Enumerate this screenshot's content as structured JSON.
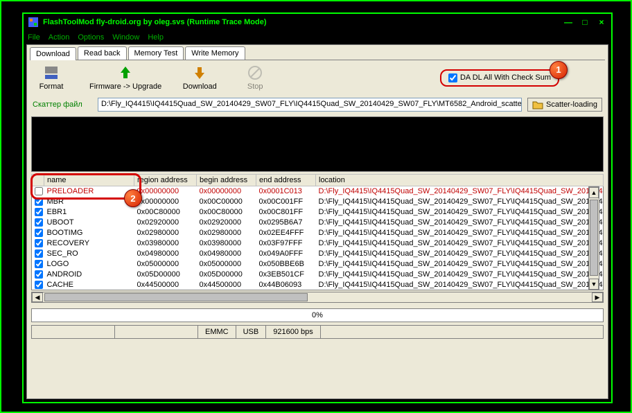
{
  "window": {
    "title": "FlashToolMod fly-droid.org by oleg.svs (Runtime Trace Mode)"
  },
  "menu": {
    "file": "File",
    "action": "Action",
    "options": "Options",
    "window": "Window",
    "help": "Help"
  },
  "tabs": {
    "download": "Download",
    "readback": "Read back",
    "memtest": "Memory Test",
    "writemem": "Write Memory"
  },
  "toolbar": {
    "format": "Format",
    "firmware_upgrade": "Firmware -> Upgrade",
    "download": "Download",
    "stop": "Stop",
    "checksum_label": "DA DL All With Check Sum"
  },
  "scatter": {
    "label": "Скаттер файл",
    "path": "D:\\Fly_IQ4415\\IQ4415Quad_SW_20140429_SW07_FLY\\IQ4415Quad_SW_20140429_SW07_FLY\\MT6582_Android_scatte",
    "button": "Scatter-loading"
  },
  "callouts": {
    "one": "1",
    "two": "2"
  },
  "columns": {
    "name": "name",
    "region": "region address",
    "begin": "begin address",
    "end": "end address",
    "location": "location"
  },
  "rows": [
    {
      "checked": false,
      "name": "PRELOADER",
      "region": "0x00000000",
      "begin": "0x00000000",
      "end": "0x0001C013",
      "location": "D:\\Fly_IQ4415\\IQ4415Quad_SW_20140429_SW07_FLY\\IQ4415Quad_SW_20140429_…",
      "red": true
    },
    {
      "checked": true,
      "name": "MBR",
      "region": "0x00000000",
      "begin": "0x00C00000",
      "end": "0x00C001FF",
      "location": "D:\\Fly_IQ4415\\IQ4415Quad_SW_20140429_SW07_FLY\\IQ4415Quad_SW_20140429_…",
      "red": false
    },
    {
      "checked": true,
      "name": "EBR1",
      "region": "0x00C80000",
      "begin": "0x00C80000",
      "end": "0x00C801FF",
      "location": "D:\\Fly_IQ4415\\IQ4415Quad_SW_20140429_SW07_FLY\\IQ4415Quad_SW_20140429_…",
      "red": false
    },
    {
      "checked": true,
      "name": "UBOOT",
      "region": "0x02920000",
      "begin": "0x02920000",
      "end": "0x0295B6A7",
      "location": "D:\\Fly_IQ4415\\IQ4415Quad_SW_20140429_SW07_FLY\\IQ4415Quad_SW_20140429_…",
      "red": false
    },
    {
      "checked": true,
      "name": "BOOTIMG",
      "region": "0x02980000",
      "begin": "0x02980000",
      "end": "0x02EE4FFF",
      "location": "D:\\Fly_IQ4415\\IQ4415Quad_SW_20140429_SW07_FLY\\IQ4415Quad_SW_20140429_…",
      "red": false
    },
    {
      "checked": true,
      "name": "RECOVERY",
      "region": "0x03980000",
      "begin": "0x03980000",
      "end": "0x03F97FFF",
      "location": "D:\\Fly_IQ4415\\IQ4415Quad_SW_20140429_SW07_FLY\\IQ4415Quad_SW_20140429_…",
      "red": false
    },
    {
      "checked": true,
      "name": "SEC_RO",
      "region": "0x04980000",
      "begin": "0x04980000",
      "end": "0x049A0FFF",
      "location": "D:\\Fly_IQ4415\\IQ4415Quad_SW_20140429_SW07_FLY\\IQ4415Quad_SW_20140429_…",
      "red": false
    },
    {
      "checked": true,
      "name": "LOGO",
      "region": "0x05000000",
      "begin": "0x05000000",
      "end": "0x050BBE6B",
      "location": "D:\\Fly_IQ4415\\IQ4415Quad_SW_20140429_SW07_FLY\\IQ4415Quad_SW_20140429_…",
      "red": false
    },
    {
      "checked": true,
      "name": "ANDROID",
      "region": "0x05D00000",
      "begin": "0x05D00000",
      "end": "0x3EB501CF",
      "location": "D:\\Fly_IQ4415\\IQ4415Quad_SW_20140429_SW07_FLY\\IQ4415Quad_SW_20140429_…",
      "red": false
    },
    {
      "checked": true,
      "name": "CACHE",
      "region": "0x44500000",
      "begin": "0x44500000",
      "end": "0x44B06093",
      "location": "D:\\Fly_IQ4415\\IQ4415Quad_SW_20140429_SW07_FLY\\IQ4415Quad_SW_20140429_…",
      "red": false
    }
  ],
  "progress": {
    "text": "0%"
  },
  "status": {
    "emmc": "EMMC",
    "usb": "USB",
    "baud": "921600 bps"
  }
}
